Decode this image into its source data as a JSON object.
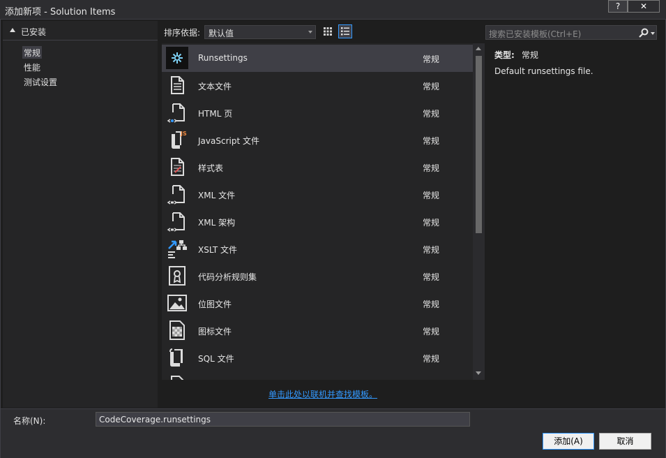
{
  "window": {
    "title": "添加新项 - Solution Items",
    "help_label": "?",
    "close_label": "✕"
  },
  "tree": {
    "header": "已安装",
    "items": [
      {
        "label": "常规",
        "selected": true
      },
      {
        "label": "性能",
        "selected": false
      },
      {
        "label": "测试设置",
        "selected": false
      }
    ]
  },
  "toolbar": {
    "sort_label": "排序依据:",
    "sort_value": "默认值",
    "view_modes": [
      "grid-view",
      "list-view"
    ],
    "active_view": "list-view"
  },
  "search": {
    "placeholder": "搜索已安装模板(Ctrl+E)"
  },
  "templates": [
    {
      "name": "Runsettings",
      "category": "常规",
      "icon": "runsettings-icon",
      "selected": true
    },
    {
      "name": "文本文件",
      "category": "常规",
      "icon": "text-file-icon",
      "selected": false
    },
    {
      "name": "HTML 页",
      "category": "常规",
      "icon": "html-page-icon",
      "selected": false
    },
    {
      "name": "JavaScript 文件",
      "category": "常规",
      "icon": "javascript-file-icon",
      "selected": false
    },
    {
      "name": "样式表",
      "category": "常规",
      "icon": "stylesheet-icon",
      "selected": false
    },
    {
      "name": "XML 文件",
      "category": "常规",
      "icon": "xml-file-icon",
      "selected": false
    },
    {
      "name": "XML 架构",
      "category": "常规",
      "icon": "xml-schema-icon",
      "selected": false
    },
    {
      "name": "XSLT 文件",
      "category": "常规",
      "icon": "xslt-file-icon",
      "selected": false
    },
    {
      "name": "代码分析规则集",
      "category": "常规",
      "icon": "ruleset-icon",
      "selected": false
    },
    {
      "name": "位图文件",
      "category": "常规",
      "icon": "bitmap-file-icon",
      "selected": false
    },
    {
      "name": "图标文件",
      "category": "常规",
      "icon": "icon-file-icon",
      "selected": false
    },
    {
      "name": "SQL 文件",
      "category": "常规",
      "icon": "sql-file-icon",
      "selected": false
    }
  ],
  "details": {
    "type_label": "类型:",
    "type_value": "常规",
    "description": "Default runsettings file."
  },
  "online_link": "单击此处以联机并查找模板。",
  "footer": {
    "name_label": "名称(N):",
    "name_value": "CodeCoverage.runsettings",
    "add_label": "添加(A)",
    "cancel_label": "取消"
  },
  "colors": {
    "background": "#1e1e1e",
    "panel": "#252526",
    "selection": "#3f3f46",
    "accent": "#3399ff",
    "text": "#e6e6e6"
  }
}
